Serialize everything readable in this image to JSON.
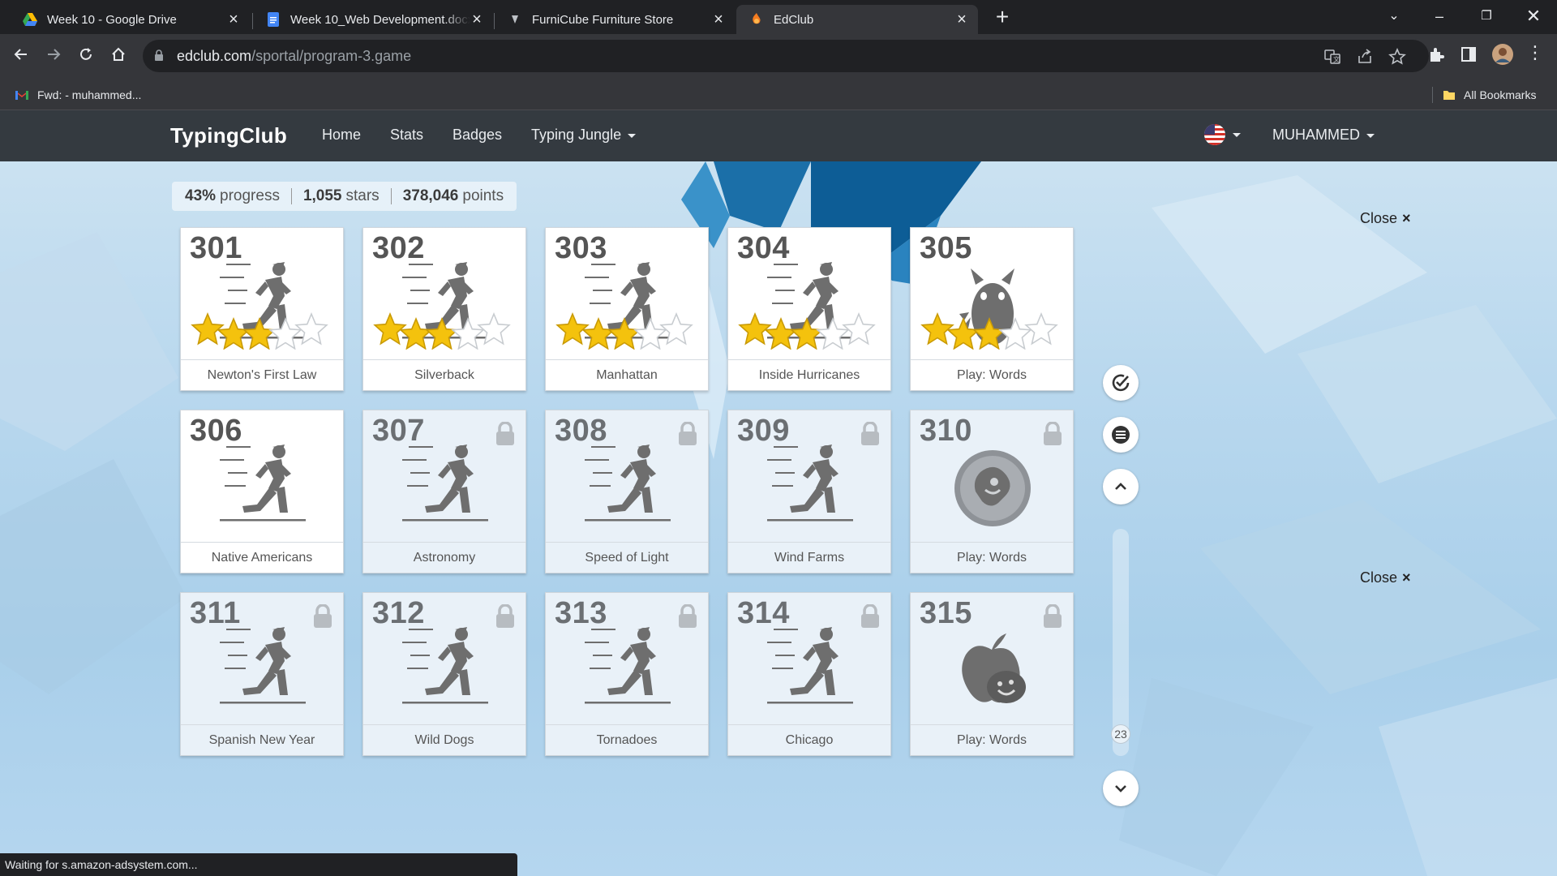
{
  "browser": {
    "tabs": [
      {
        "title": "Week 10 - Google Drive",
        "icon": "google-drive-icon"
      },
      {
        "title": "Week 10_Web Development.docx",
        "icon": "google-docs-icon"
      },
      {
        "title": "FurniCube Furniture Store",
        "icon": "furnicube-icon"
      },
      {
        "title": "EdClub",
        "icon": "edclub-icon"
      }
    ],
    "url_domain": "edclub.com",
    "url_path": "/sportal/program-3.game",
    "bookmark": "Fwd: - muhammed...",
    "all_bookmarks": "All Bookmarks",
    "status": "Waiting for s.amazon-adsystem.com..."
  },
  "nav": {
    "brand": "TypingClub",
    "links": [
      "Home",
      "Stats",
      "Badges"
    ],
    "jungle": "Typing Jungle",
    "user": "MUHAMMED"
  },
  "stats": {
    "progress_value": "43%",
    "progress_label": "progress",
    "stars_value": "1,055",
    "stars_label": "stars",
    "points_value": "378,046",
    "points_label": "points"
  },
  "close_label": "Close",
  "close_icon": "×",
  "scroll_indicator": "23",
  "cards": [
    {
      "num": "301",
      "label": "Newton's First Law",
      "locked": false,
      "stars": 3,
      "icon": "runner"
    },
    {
      "num": "302",
      "label": "Silverback",
      "locked": false,
      "stars": 3,
      "icon": "runner"
    },
    {
      "num": "303",
      "label": "Manhattan",
      "locked": false,
      "stars": 3,
      "icon": "runner"
    },
    {
      "num": "304",
      "label": "Inside Hurricanes",
      "locked": false,
      "stars": 3,
      "icon": "runner"
    },
    {
      "num": "305",
      "label": "Play: Words",
      "locked": false,
      "stars": 3,
      "icon": "monster-game"
    },
    {
      "num": "306",
      "label": "Native Americans",
      "locked": false,
      "stars": 0,
      "icon": "runner"
    },
    {
      "num": "307",
      "label": "Astronomy",
      "locked": true,
      "stars": 0,
      "icon": "runner"
    },
    {
      "num": "308",
      "label": "Speed of Light",
      "locked": true,
      "stars": 0,
      "icon": "runner"
    },
    {
      "num": "309",
      "label": "Wind Farms",
      "locked": true,
      "stars": 0,
      "icon": "runner"
    },
    {
      "num": "310",
      "label": "Play: Words",
      "locked": true,
      "stars": 0,
      "icon": "game-badge"
    },
    {
      "num": "311",
      "label": "Spanish New Year",
      "locked": true,
      "stars": 0,
      "icon": "runner"
    },
    {
      "num": "312",
      "label": "Wild Dogs",
      "locked": true,
      "stars": 0,
      "icon": "runner"
    },
    {
      "num": "313",
      "label": "Tornadoes",
      "locked": true,
      "stars": 0,
      "icon": "runner"
    },
    {
      "num": "314",
      "label": "Chicago",
      "locked": true,
      "stars": 0,
      "icon": "runner"
    },
    {
      "num": "315",
      "label": "Play: Words",
      "locked": true,
      "stars": 0,
      "icon": "apple-game"
    }
  ],
  "colors": {
    "star_fill": "#f4c20d",
    "star_stroke": "#c99a06",
    "icon_gray": "#6e6e6e"
  }
}
